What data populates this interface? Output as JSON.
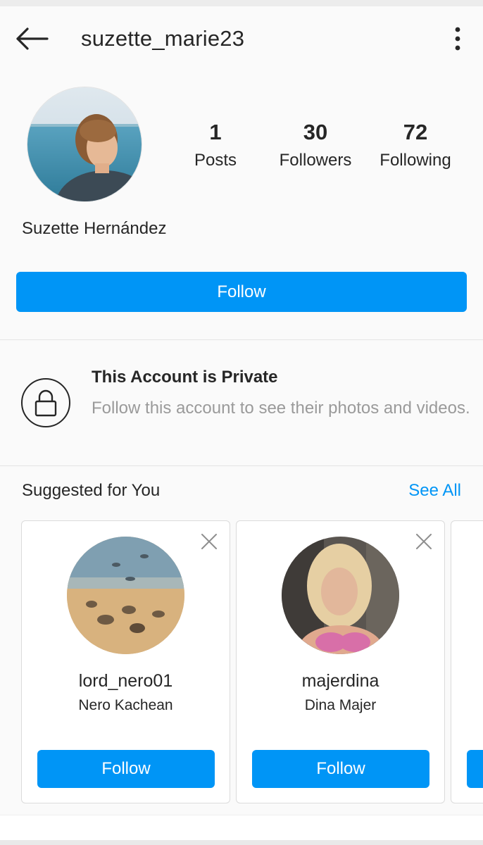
{
  "header": {
    "username": "suzette_marie23",
    "back_icon": "arrow-left-icon",
    "more_icon": "more-vertical-icon"
  },
  "profile": {
    "stats": [
      {
        "value": "1",
        "label": "Posts"
      },
      {
        "value": "30",
        "label": "Followers"
      },
      {
        "value": "72",
        "label": "Following"
      }
    ],
    "full_name": "Suzette Hernández",
    "follow_label": "Follow"
  },
  "private": {
    "icon": "lock-icon",
    "title": "This Account is Private",
    "subtitle": "Follow this account to see their photos and videos."
  },
  "suggestions": {
    "title": "Suggested for You",
    "see_all": "See All",
    "cards": [
      {
        "username": "lord_nero01",
        "name": "Nero Kachean",
        "follow_label": "Follow"
      },
      {
        "username": "majerdina",
        "name": "Dina Majer",
        "follow_label": "Follow"
      }
    ]
  },
  "colors": {
    "accent": "#0095f6",
    "background": "#fafafa",
    "text": "#262626",
    "muted": "#9a9a9a"
  }
}
